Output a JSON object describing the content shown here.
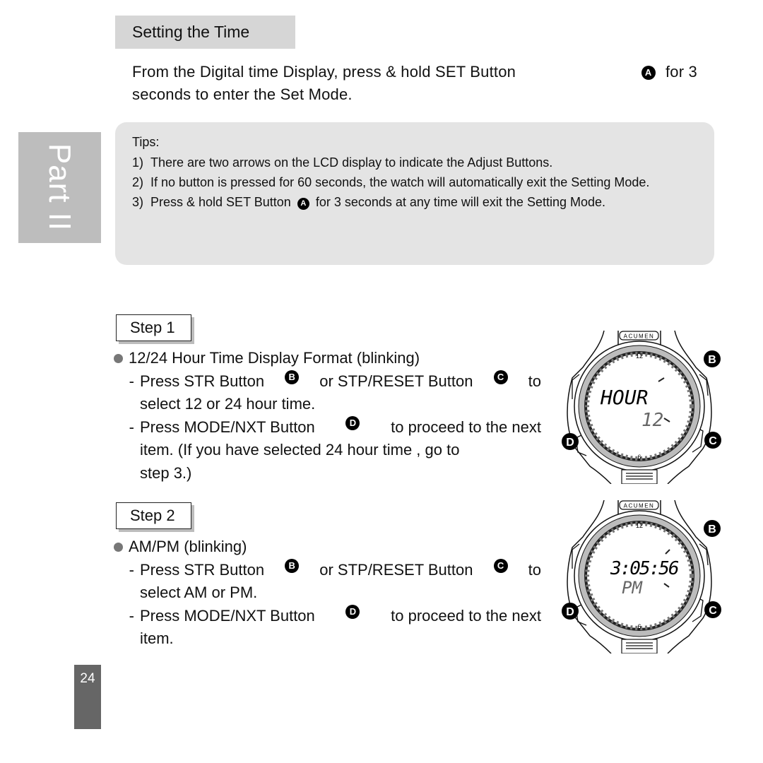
{
  "section": {
    "title": "Setting the Time",
    "intro_line1_a": "From the Digital time Display, press & hold SET Button",
    "intro_line1_b": "for 3",
    "intro_line2": "seconds to enter the Set Mode.",
    "button_a": "A"
  },
  "side_tab": {
    "label": "Part II"
  },
  "tips": {
    "title": "Tips:",
    "items": [
      {
        "num": "1)",
        "text": "There are two arrows on the LCD display to indicate the Adjust Buttons."
      },
      {
        "num": "2)",
        "text": "If no button is pressed for 60 seconds, the watch will automatically exit the Setting Mode."
      },
      {
        "num": "3)",
        "text_a": "Press & hold SET Button",
        "button": "A",
        "text_b": "for 3 seconds at any time will exit the Setting Mode."
      }
    ]
  },
  "steps": [
    {
      "label": "Step 1",
      "heading": "12/24 Hour Time Display Format (blinking)",
      "sub1_a": "Press STR Button",
      "sub1_btn1": "B",
      "sub1_b": "or STP/RESET Button",
      "sub1_btn2": "C",
      "sub1_c": "to",
      "sub1_line2": "select 12 or 24 hour time.",
      "sub2_a": "Press MODE/NXT Button",
      "sub2_btn": "D",
      "sub2_b": "to proceed to the next",
      "sub2_line2": "item. (If you have  selected 24 hour time , go to",
      "sub2_line3": "step 3.)",
      "watch": {
        "brand": "ACUMEN",
        "lcd_top": "HOUR",
        "lcd_bottom": "12",
        "dial_top": "12",
        "dial_bottom": "6",
        "btn_b": "B",
        "btn_c": "C",
        "btn_d": "D"
      }
    },
    {
      "label": "Step 2",
      "heading": "AM/PM (blinking)",
      "sub1_a": "Press STR Button",
      "sub1_btn1": "B",
      "sub1_b": "or STP/RESET Button",
      "sub1_btn2": "C",
      "sub1_c": "to",
      "sub1_line2": "select AM or PM.",
      "sub2_a": "Press MODE/NXT Button",
      "sub2_btn": "D",
      "sub2_b": "to proceed to the next",
      "sub2_line2": "item.",
      "watch": {
        "brand": "ACUMEN",
        "lcd_top": "3:05:56",
        "lcd_bottom": "PM",
        "dial_top": "12",
        "dial_bottom": "6",
        "btn_b": "B",
        "btn_c": "C",
        "btn_d": "D"
      }
    }
  ],
  "page": {
    "number": "24"
  }
}
